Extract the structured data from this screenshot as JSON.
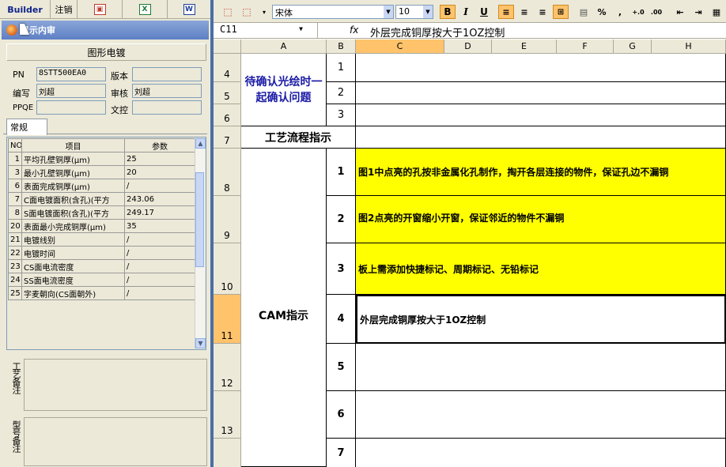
{
  "left_toolbar": {
    "builder": "Builder",
    "logout": "注销"
  },
  "panel": {
    "title": "显示内审",
    "section": "图形电镀",
    "labels": {
      "pn": "PN",
      "version": "版本",
      "editor": "编写",
      "reviewer": "审核",
      "ppqe": "PPQE",
      "controller": "文控"
    },
    "values": {
      "pn": "8STT500EA0",
      "version": "",
      "editor": "刘超",
      "reviewer": "刘超",
      "ppqe": "",
      "controller": ""
    },
    "tab": "常规",
    "table": {
      "headers": [
        "NO",
        "项目",
        "参数"
      ],
      "rows": [
        [
          "1",
          "平均孔壁铜厚(μm)",
          "25"
        ],
        [
          "3",
          "最小孔壁铜厚(μm)",
          "20"
        ],
        [
          "6",
          "表面完成铜厚(μm)",
          "/"
        ],
        [
          "7",
          "C面电镀面积(含孔)(平方",
          "243.06"
        ],
        [
          "8",
          "S面电镀面积(含孔)(平方",
          "249.17"
        ],
        [
          "20",
          "表面最小完成铜厚(μm)",
          "35"
        ],
        [
          "21",
          "电镀线别",
          "/"
        ],
        [
          "22",
          "电镀时间",
          "/"
        ],
        [
          "23",
          "CS面电流密度",
          "/"
        ],
        [
          "24",
          "SS面电流密度",
          "/"
        ],
        [
          "25",
          "字麦朝向(CS面朝外)",
          "/"
        ]
      ]
    },
    "memo1_label": "工艺备注",
    "memo2_label": "型号备注"
  },
  "excel": {
    "font_name": "宋体",
    "font_size": "10",
    "cell_ref": "C11",
    "formula": "外层完成铜厚按大于1OZ控制",
    "columns": [
      "A",
      "B",
      "C",
      "D",
      "E",
      "F",
      "G",
      "H"
    ],
    "rows": [
      "4",
      "5",
      "6",
      "7",
      "8",
      "9",
      "10",
      "11",
      "12",
      "13"
    ],
    "confirm_label": "待确认光绘时一起确认问题",
    "confirm_nums": [
      "1",
      "2",
      "3"
    ],
    "process_label": "工艺流程指示",
    "cam_label": "CAM指示",
    "cam_nums": [
      "1",
      "2",
      "3",
      "4",
      "5",
      "6",
      "7"
    ],
    "cam_texts": [
      "图1中点亮的孔按非金属化孔制作，掏开各层连接的物件，保证孔边不漏铜",
      "图2点亮的开窗缩小开窗，保证邻近的物件不漏铜",
      "板上需添加快捷标记、周期标记、无铅标记",
      "外层完成铜厚按大于1OZ控制"
    ]
  }
}
